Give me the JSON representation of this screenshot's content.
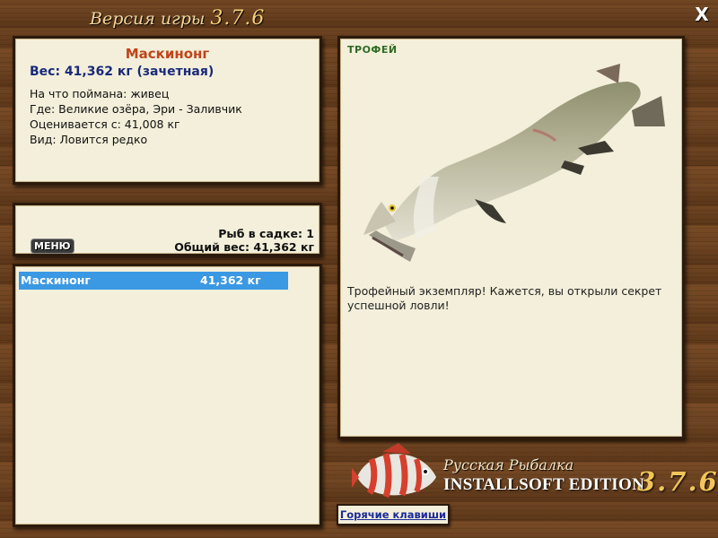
{
  "window": {
    "title_text": "Версия игры",
    "title_version": "3.7.6",
    "close_label": "X"
  },
  "fish_info": {
    "name": "Маскинонг",
    "weight": "Вес: 41,362 кг (зачетная)",
    "caught_on": "На что поймана: живец",
    "location": "Где: Великие озёра, Эри - Заливчик",
    "rated_from": "Оценивается с: 41,008 кг",
    "species": "Вид: Ловится редко"
  },
  "stats": {
    "menu_label": "МЕНЮ",
    "fish_count": "Рыб в садке: 1",
    "total_weight": "Общий вес: 41,362 кг"
  },
  "catch_list": [
    {
      "name": "Маскинонг",
      "weight": "41,362 кг"
    }
  ],
  "trophy": {
    "label": "ТРОФЕЙ",
    "image_icon": "muskellunge-fish-icon",
    "description": "Трофейный экземпляр! Кажется, вы открыли секрет успешной ловли!"
  },
  "brand": {
    "title": "Русская Рыбалка",
    "edition": "INSTALLSOFT EDITION",
    "version": "3.7.6",
    "logo_icon": "red-striped-fish-icon"
  },
  "hotkeys_label": "Горячие клавиши"
}
